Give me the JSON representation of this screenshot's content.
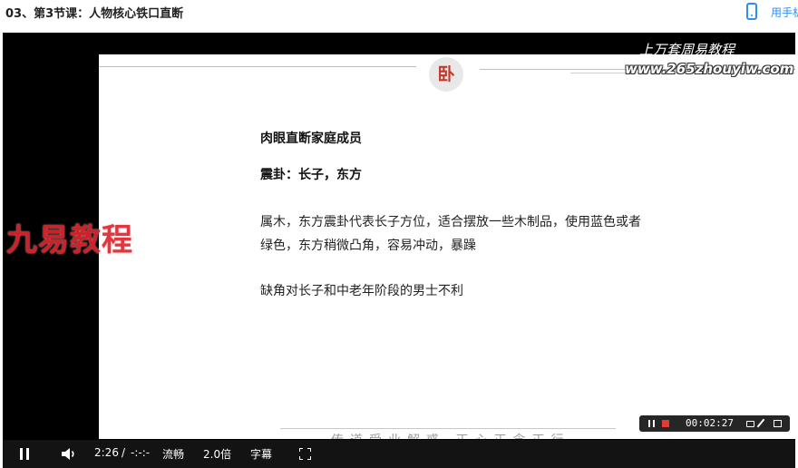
{
  "header": {
    "course_title": "03、第3节课：人物核心铁口直断",
    "phone_link": "用手机"
  },
  "video": {
    "overlay_line1": "上万套周易教程",
    "overlay_line2": "www.265zhouyiw.com",
    "brand_watermark": "九易教程",
    "slide": {
      "emblem": "卧",
      "heading": "肉眼直断家庭成员",
      "subheading": "震卦：长子，东方",
      "paragraph": "属木，东方震卦代表长子方位，适合摆放一些木制品，使用蓝色或者绿色，东方稍微凸角，容易冲动，暴躁",
      "paragraph2": "缺角对长子和中老年阶段的男士不利",
      "motto": "传道受业解惑 正心正念正行"
    },
    "recorder": {
      "time": "00:02:27"
    },
    "controls": {
      "current_time": "2:26",
      "separator": "/",
      "duration": "-:-:-",
      "quality": "流畅",
      "speed": "2.0倍",
      "subtitles": "字幕"
    }
  }
}
